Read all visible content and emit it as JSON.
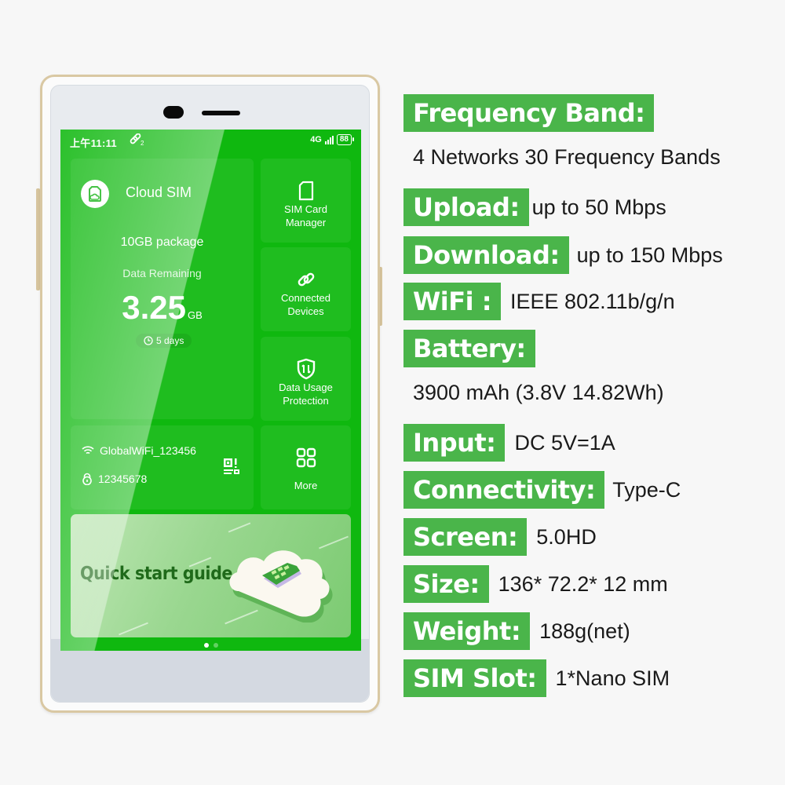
{
  "device": {
    "status_bar": {
      "time": "上午11:11",
      "link_count": "2",
      "network": "4G",
      "battery": "88"
    },
    "cloud_sim_card": {
      "title": "Cloud SIM",
      "package": "10GB package",
      "remaining_label": "Data Remaining",
      "remaining_value": "3.25",
      "remaining_unit": "GB",
      "days": "5 days"
    },
    "tiles": [
      {
        "label_line1": "SIM Card",
        "label_line2": "Manager",
        "icon": "sim-card-icon"
      },
      {
        "label_line1": "Connected",
        "label_line2": "Devices",
        "icon": "link-icon"
      },
      {
        "label_line1": "Data Usage",
        "label_line2": "Protection",
        "icon": "shield-icon"
      },
      {
        "label_line1": "More",
        "label_line2": "",
        "icon": "grid-icon"
      }
    ],
    "wifi": {
      "ssid": "GlobalWiFi_123456",
      "password": "12345678"
    },
    "banner": {
      "title": "Quick start guide",
      "pages": 2,
      "active_page": 1
    }
  },
  "specs": [
    {
      "label": "Frequency Band:",
      "value": "4 Networks 30 Frequency Bands",
      "value_below": true
    },
    {
      "label": "Upload:",
      "value": "up to 50 Mbps"
    },
    {
      "label": "Download:",
      "value": "up to 150 Mbps"
    },
    {
      "label": "WiFi :",
      "value": "IEEE 802.11b/g/n"
    },
    {
      "label": "Battery:",
      "value": "3900 mAh (3.8V 14.82Wh)",
      "value_below": true
    },
    {
      "label": "Input:",
      "value": "DC 5V=1A"
    },
    {
      "label": "Connectivity:",
      "value": "Type-C"
    },
    {
      "label": "Screen:",
      "value": "5.0HD"
    },
    {
      "label": "Size:",
      "value": "136* 72.2* 12 mm"
    },
    {
      "label": "Weight:",
      "value": "188g(net)"
    },
    {
      "label": "SIM Slot:",
      "value": "1*Nano SIM"
    }
  ],
  "colors": {
    "brand_green": "#4ab54a",
    "screen_green": "#0fb80f",
    "frame_gold": "#d9c8a3"
  }
}
